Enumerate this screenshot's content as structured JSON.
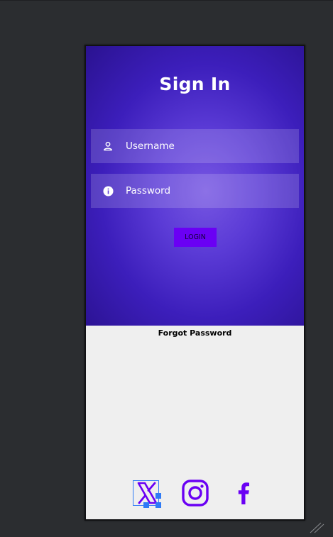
{
  "screen": {
    "title": "Sign In",
    "username_placeholder": "Username",
    "password_placeholder": "Password",
    "login_label": "LOGIN",
    "forgot_label": "Forgot Password"
  },
  "social": [
    {
      "icon": "x-icon"
    },
    {
      "icon": "instagram-icon"
    },
    {
      "icon": "facebook-icon"
    }
  ],
  "colors": {
    "accent": "#6a00f4",
    "gradient_center": "#7656e2",
    "gradient_edge": "#2a1290",
    "background_light": "#efefef",
    "selection": "#2f7bf6",
    "editor_bg": "#2b2d30"
  }
}
